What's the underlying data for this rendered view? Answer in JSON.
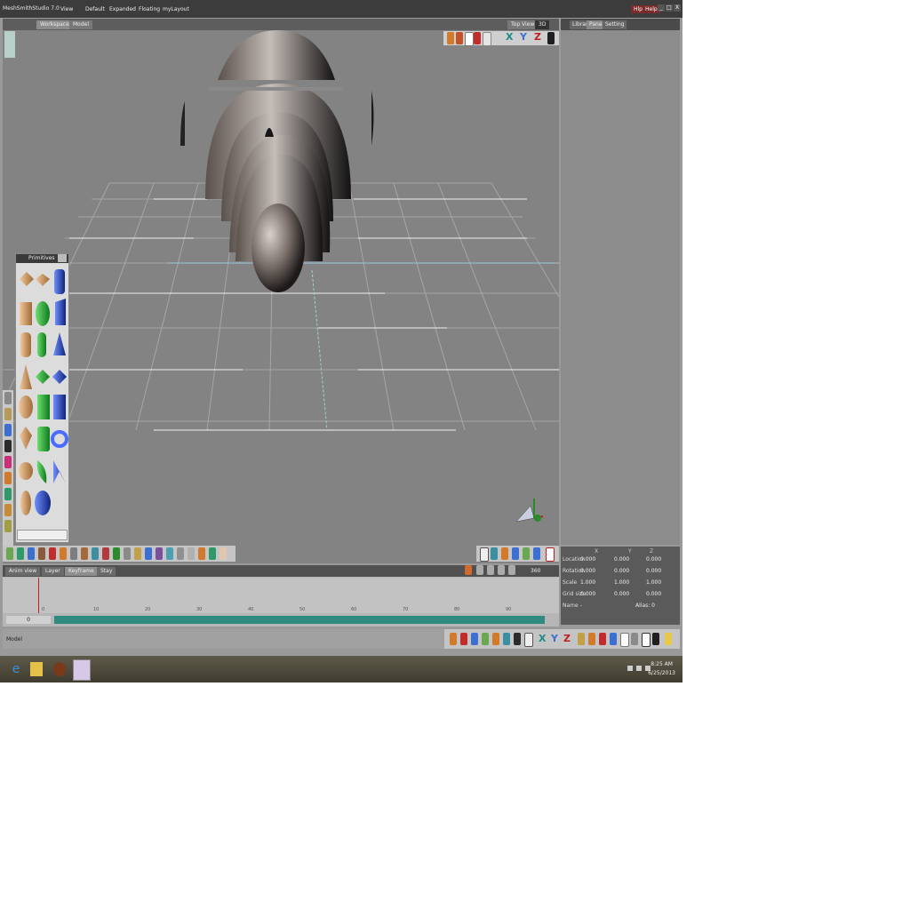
{
  "app": {
    "title": "MeshSmithStudio 7.0",
    "menu": [
      "View",
      "Default",
      "Expanded",
      "Floating",
      "myLayout"
    ],
    "win_buttons": [
      "Hlp",
      "Help"
    ],
    "win_controls": [
      "_",
      "□",
      "X"
    ]
  },
  "viewport": {
    "left_tab": "Workspace",
    "tabs": [
      "Workspace",
      "Model"
    ],
    "view_mode": "3D",
    "view_label": "Top View"
  },
  "right_panel": {
    "tabs": [
      "Library",
      "Panel",
      "Setting"
    ]
  },
  "transform": {
    "headers": [
      "X",
      "Y",
      "Z"
    ],
    "rows": [
      {
        "label": "Location",
        "values": [
          "0.000",
          "0.000",
          "0.000"
        ]
      },
      {
        "label": "Rotation",
        "values": [
          "0.000",
          "0.000",
          "0.000"
        ]
      },
      {
        "label": "Scale",
        "values": [
          "1.000",
          "1.000",
          "1.000"
        ]
      },
      {
        "label": "Grid size",
        "values": [
          "0.000",
          "0.000",
          "0.000"
        ]
      }
    ],
    "name_label": "Name",
    "name_value": "-",
    "frame_label": "Alias: 0"
  },
  "timeline": {
    "tabs": [
      "Anim view",
      "Layer",
      "Keyframe",
      "Stay"
    ],
    "frame_value": "0",
    "end_value": "360",
    "ticks": [
      "0",
      "10",
      "20",
      "30",
      "40",
      "50",
      "60",
      "70",
      "80",
      "90"
    ]
  },
  "palette": {
    "title": "Primitives"
  },
  "axes": {
    "x_label": "X",
    "y_label": "Y",
    "z_label": "Z"
  },
  "status": {
    "text": "Model"
  },
  "taskbar": {
    "time": "8:25 AM",
    "date": "6/25/2013"
  },
  "colors": {
    "viewport_bg": "#838383",
    "grid": "#a6a6a6",
    "timeline_bar": "#2f8a80",
    "accent_red": "#c01f1f"
  }
}
